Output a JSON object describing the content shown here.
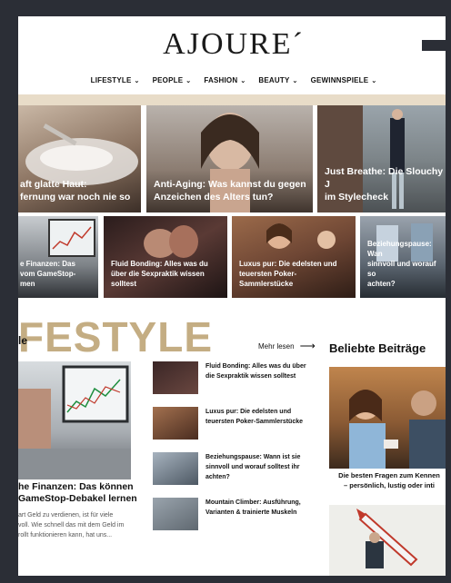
{
  "logo": "AJOURE´",
  "nav": [
    {
      "label": "LIFESTYLE"
    },
    {
      "label": "PEOPLE"
    },
    {
      "label": "FASHION"
    },
    {
      "label": "BEAUTY"
    },
    {
      "label": "GEWINNSPIELE"
    }
  ],
  "hero_cards": [
    {
      "caption": "aft glatte Haut:\nfernung war noch nie so"
    },
    {
      "caption": "Anti-Aging: Was kannst du gegen\nAnzeichen des Alters tun?"
    },
    {
      "caption": "Just Breathe: Die Slouchy J\nim Stylecheck"
    }
  ],
  "small_cards": [
    {
      "caption": "e Finanzen: Das\nvom GameStop-\nmen"
    },
    {
      "caption": "Fluid Bonding: Alles was du\nüber die Sexpraktik wissen\nsolltest"
    },
    {
      "caption": "Luxus pur: Die edelsten und\nteuersten Poker-\nSammlerstücke"
    },
    {
      "caption": "Beziehungspause: Wan\nsinnvoll und worauf so\nachten?"
    }
  ],
  "section": {
    "title": "FESTYLE",
    "tag": "le",
    "more_label": "Mehr lesen",
    "popular_heading": "Beliebte Beiträge"
  },
  "featured": {
    "title": "he Finanzen: Das können\nGameStop-Debakel lernen",
    "desc": "art Geld zu verdienen, ist für viele\nvoll. Wie schnell das mit dem Geld im\nrollt funktionieren kann, hat uns..."
  },
  "list": [
    {
      "text": "Fluid Bonding: Alles was du über\ndie Sexpraktik wissen solltest"
    },
    {
      "text": "Luxus pur: Die edelsten und\nteuersten Poker-Sammlerstücke"
    },
    {
      "text": "Beziehungspause: Wann ist sie\nsinnvoll und worauf solltest ihr\nachten?"
    },
    {
      "text": "Mountain Climber: Ausführung,\nVarianten & trainierte Muskeln"
    }
  ],
  "popular": [
    {
      "title": "Die besten Fragen zum Kennen\n– persönlich, lustig oder inti"
    }
  ]
}
